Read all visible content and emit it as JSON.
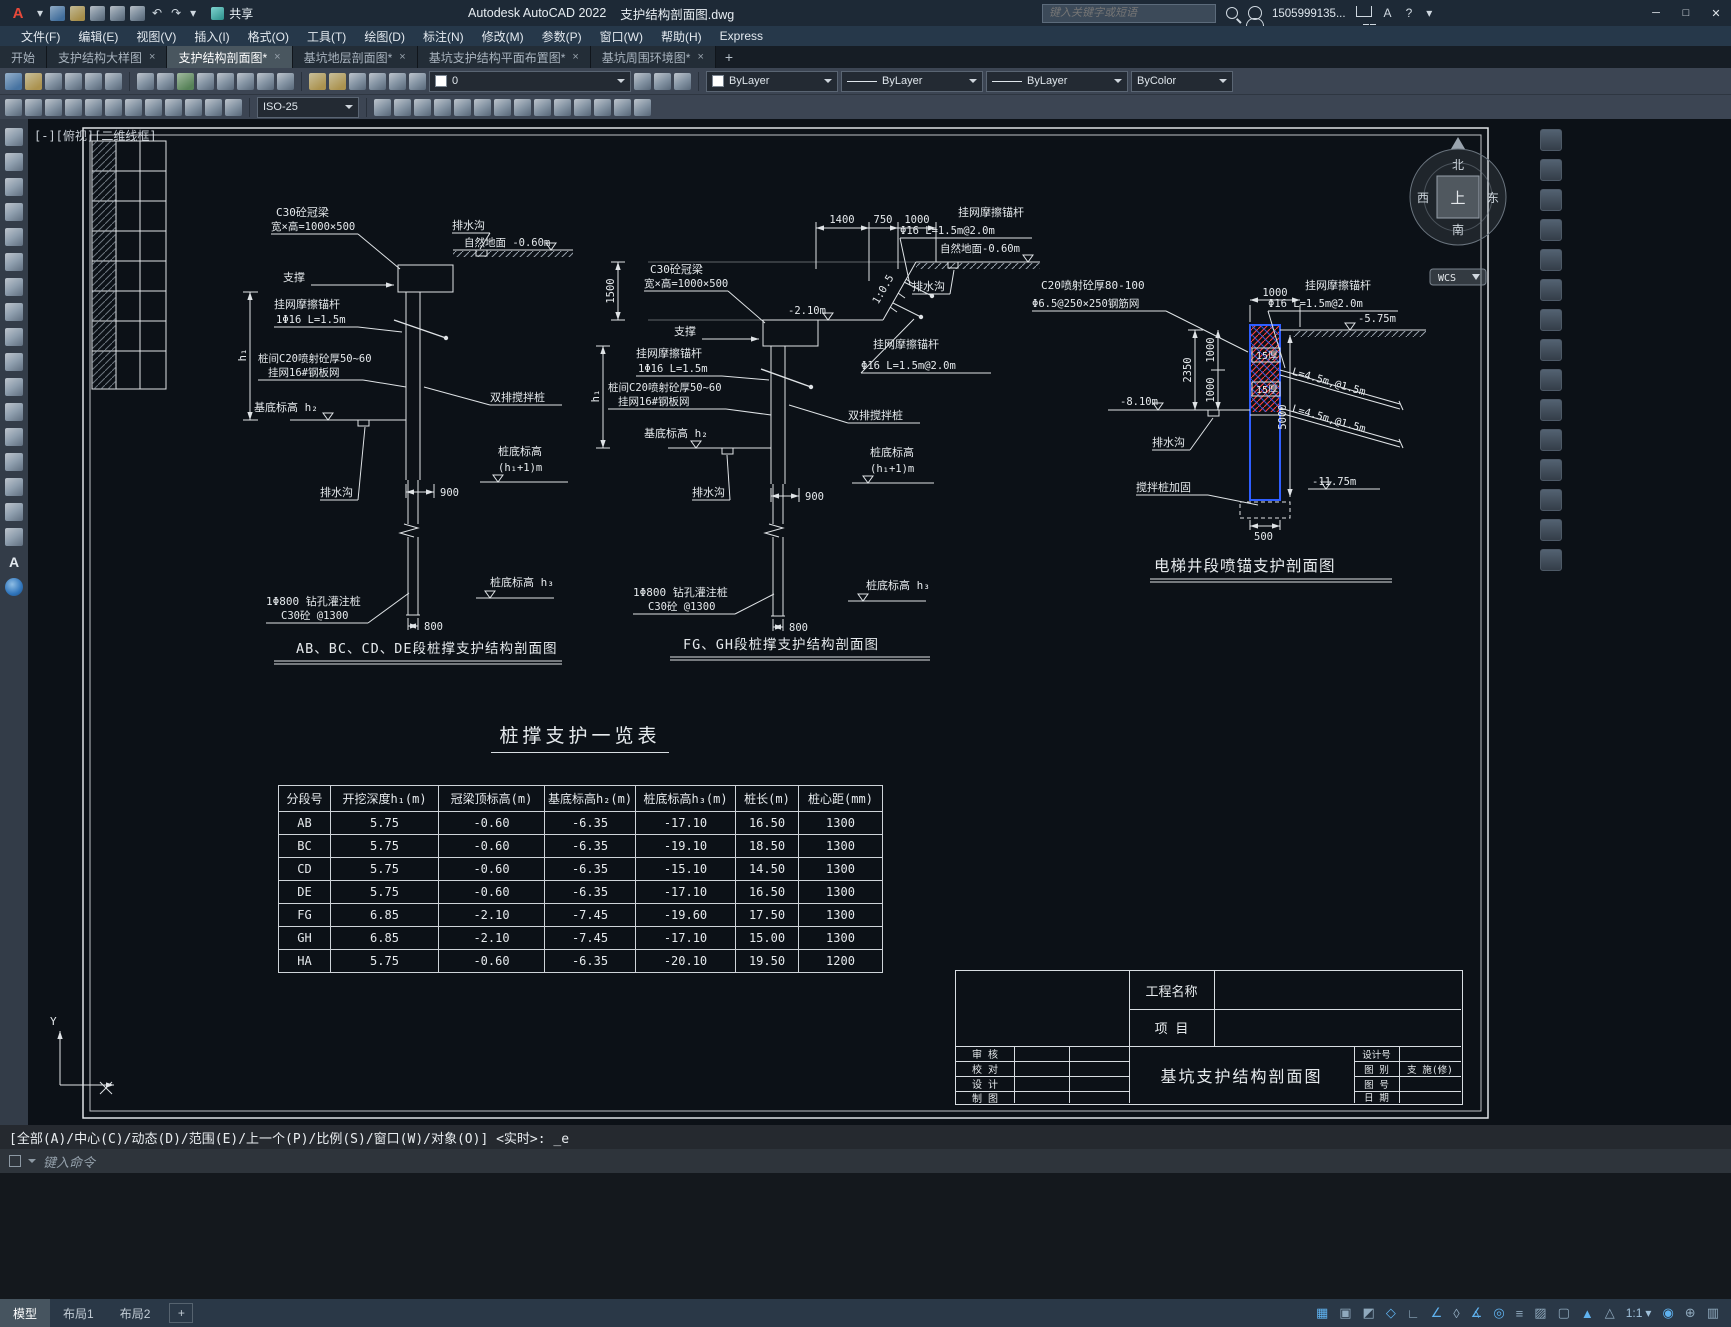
{
  "titlebar": {
    "logo_letter": "A",
    "app_title": "Autodesk AutoCAD 2022",
    "doc_title": "支护结构剖面图.dwg",
    "share_label": "共享",
    "search_placeholder": "键入关键字或短语",
    "username": "1505999135...",
    "undo_glyph": "↶",
    "redo_glyph": "↷",
    "caret_glyph": "▾",
    "help_glyph": "?",
    "min_glyph": "─",
    "max_glyph": "□",
    "close_glyph": "✕"
  },
  "menubar": {
    "items": [
      "文件(F)",
      "编辑(E)",
      "视图(V)",
      "插入(I)",
      "格式(O)",
      "工具(T)",
      "绘图(D)",
      "标注(N)",
      "修改(M)",
      "参数(P)",
      "窗口(W)",
      "帮助(H)",
      "Express"
    ]
  },
  "filetabs": {
    "start_tab": "开始",
    "tabs": [
      {
        "label": "支护结构大样图"
      },
      {
        "label": "支护结构剖面图*"
      },
      {
        "label": "基坑地层剖面图*"
      },
      {
        "label": "基坑支护结构平面布置图*"
      },
      {
        "label": "基坑周围环境图*"
      }
    ],
    "close_glyph": "×",
    "new_tab_glyph": "+"
  },
  "toolbars": {
    "layer_value": "0",
    "color_value": "ByLayer",
    "linetype_value": "ByLayer",
    "lineweight_value": "ByLayer",
    "plotstyle_value": "ByColor",
    "dimstyle_value": "ISO-25"
  },
  "lefttools": {
    "text_tool_glyph": "A"
  },
  "canvas": {
    "viewport_label": "[-][俯视][二维线框]",
    "compass": {
      "north": "北",
      "south": "南",
      "east": "东",
      "west": "西",
      "top": "上",
      "wcs": "WCS"
    },
    "ucs_y": "Y"
  },
  "drawing": {
    "s1": {
      "title": "AB、BC、CD、DE段桩撑支护结构剖面图",
      "crown_beam": "C30砼冠梁",
      "crown_beam_size": "宽×高=1000×500",
      "drain_top": "排水沟",
      "ground": "自然地面 -0.60m",
      "strut": "支撑",
      "anchor": "挂网摩擦锚杆",
      "anchor_spec": "1Φ16 L=1.5m",
      "dim_h1": "h₁",
      "shotcrete": "桩间C20喷射砼厚50~60",
      "mesh": "挂网16#钢板网",
      "base_level": "基底标高 h₂",
      "mixing_pile": "双排搅拌桩",
      "pile_bottom_label": "桩底标高",
      "pile_bottom_value": "(h₁+1)m",
      "drain_bottom": "排水沟",
      "dim_900": "900",
      "bored_pile": "1Φ800 钻孔灌注桩",
      "bored_pile_spec": "C30砼 @1300",
      "dim_800": "800",
      "pile_tip_level": "桩底标高 h₃"
    },
    "s2": {
      "title": "FG、GH段桩撑支护结构剖面图",
      "dim_1400": "1400",
      "dim_750": "750",
      "dim_1000": "1000",
      "dim_1500": "1500",
      "slope": "1:0.5",
      "bench_level": "-2.10m",
      "crown_beam": "C30砼冠梁",
      "crown_beam_size": "宽×高=1000×500",
      "ground": "自然地面-0.60m",
      "drain_top": "排水沟",
      "anchor_slope": "挂网摩擦锚杆",
      "anchor_slope_spec": "Φ16 L=1.5m@2.0m",
      "strut": "支撑",
      "anchor": "挂网摩擦锚杆",
      "anchor_spec": "1Φ16 L=1.5m",
      "shotcrete": "桩间C20喷射砼厚50~60",
      "mesh": "挂网16#钢板网",
      "dim_h1": "h₁",
      "base_level": "基底标高 h₂",
      "mixing_pile": "双排搅拌桩",
      "anchor_right": "挂网摩擦锚杆",
      "anchor_right_spec": "Φ16 L=1.5m@2.0m",
      "pile_bottom_label": "桩底标高",
      "pile_bottom_value": "(h₁+1)m",
      "drain_bottom": "排水沟",
      "dim_900": "900",
      "bored_pile": "1Φ800 钻孔灌注桩",
      "bored_pile_spec": "C30砼 @1300",
      "dim_800": "800",
      "pile_tip_level": "桩底标高 h₃"
    },
    "s3": {
      "title": "电梯井段喷锚支护剖面图",
      "shotcrete": "C20喷射砼厚80-100",
      "mesh": "Φ6.5@250×250钢筋网",
      "dim_1000_top": "1000",
      "anchor": "挂网摩擦锚杆",
      "anchor_spec": "Φ16 L=1.5m@2.0m",
      "level_575": "-5.75m",
      "dim_2350": "2350",
      "dim_1000_a": "1000",
      "dim_1000_b": "1000",
      "level_810": "-8.10m",
      "tag_15a": "15厚",
      "tag_15b": "15厚",
      "anchor_len_1": "L=4.5m,@1.5m",
      "anchor_len_2": "L=4.5m,@1.5m",
      "drain": "排水沟",
      "mix_reinforce": "搅拌桩加固",
      "level_1175": "-11.75m",
      "dim_500": "500",
      "dim_5000": "5000"
    }
  },
  "table": {
    "title": "桩撑支护一览表",
    "headers": [
      "分段号",
      "开挖深度h₁(m)",
      "冠梁顶标高(m)",
      "基底标高h₂(m)",
      "桩底标高h₃(m)",
      "桩长(m)",
      "桩心距(mm)"
    ],
    "rows": [
      [
        "AB",
        "5.75",
        "-0.60",
        "-6.35",
        "-17.10",
        "16.50",
        "1300"
      ],
      [
        "BC",
        "5.75",
        "-0.60",
        "-6.35",
        "-19.10",
        "18.50",
        "1300"
      ],
      [
        "CD",
        "5.75",
        "-0.60",
        "-6.35",
        "-15.10",
        "14.50",
        "1300"
      ],
      [
        "DE",
        "5.75",
        "-0.60",
        "-6.35",
        "-17.10",
        "16.50",
        "1300"
      ],
      [
        "FG",
        "6.85",
        "-2.10",
        "-7.45",
        "-19.60",
        "17.50",
        "1300"
      ],
      [
        "GH",
        "6.85",
        "-2.10",
        "-7.45",
        "-17.10",
        "15.00",
        "1300"
      ],
      [
        "HA",
        "5.75",
        "-0.60",
        "-6.35",
        "-20.10",
        "19.50",
        "1200"
      ]
    ]
  },
  "titleblock": {
    "project_label": "工程名称",
    "item_label": "项  目",
    "review": "审 核",
    "check": "校 对",
    "design": "设 计",
    "draft": "制 图",
    "drawing_name": "基坑支护结构剖面图",
    "design_no_label": "设计号",
    "fig_type_label": "图 别",
    "fig_type_value": "支 施(修)",
    "fig_no_label": "图 号",
    "date_label": "日 期"
  },
  "commandline": {
    "history": "[全部(A)/中心(C)/动态(D)/范围(E)/上一个(P)/比例(S)/窗口(W)/对象(O)] <实时>: _e",
    "prompt": "键入命令"
  },
  "statusbar": {
    "model_tab": "模型",
    "layout1_tab": "布局1",
    "layout2_tab": "布局2",
    "new_layout_glyph": "+",
    "scale": "1:1",
    "caret": "▾",
    "icons": [
      "▦",
      "▣",
      "◩",
      "◇",
      "∟",
      "∠",
      "◊",
      "∡",
      "◎",
      "≡",
      "▨",
      "▢",
      "▲",
      "△",
      "◉",
      "⊕",
      "▥"
    ]
  }
}
